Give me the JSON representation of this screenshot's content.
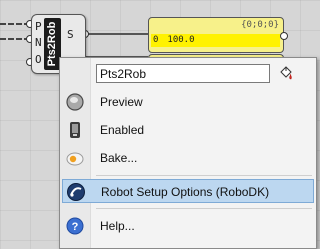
{
  "node": {
    "title": "Pts2Rob",
    "inputs": [
      "P",
      "N",
      "O"
    ],
    "outputs": [
      "S"
    ]
  },
  "panels": [
    {
      "header": "{0;0;0}",
      "row_index": "0",
      "row_value": "100.0"
    }
  ],
  "context_menu": {
    "name_value": "Pts2Rob",
    "items": [
      {
        "label": "Preview",
        "icon": "preview-icon"
      },
      {
        "label": "Enabled",
        "icon": "enabled-icon"
      },
      {
        "label": "Bake...",
        "icon": "bake-icon"
      },
      {
        "label": "Robot Setup Options (RoboDK)",
        "icon": "robodk-icon",
        "highlighted": true
      },
      {
        "label": "Help...",
        "icon": "help-icon"
      }
    ]
  },
  "colors": {
    "canvas": "#d6d6d6",
    "panel": "#f7f18a",
    "panel_row": "#fff200",
    "highlight": "#bcd7f0"
  }
}
